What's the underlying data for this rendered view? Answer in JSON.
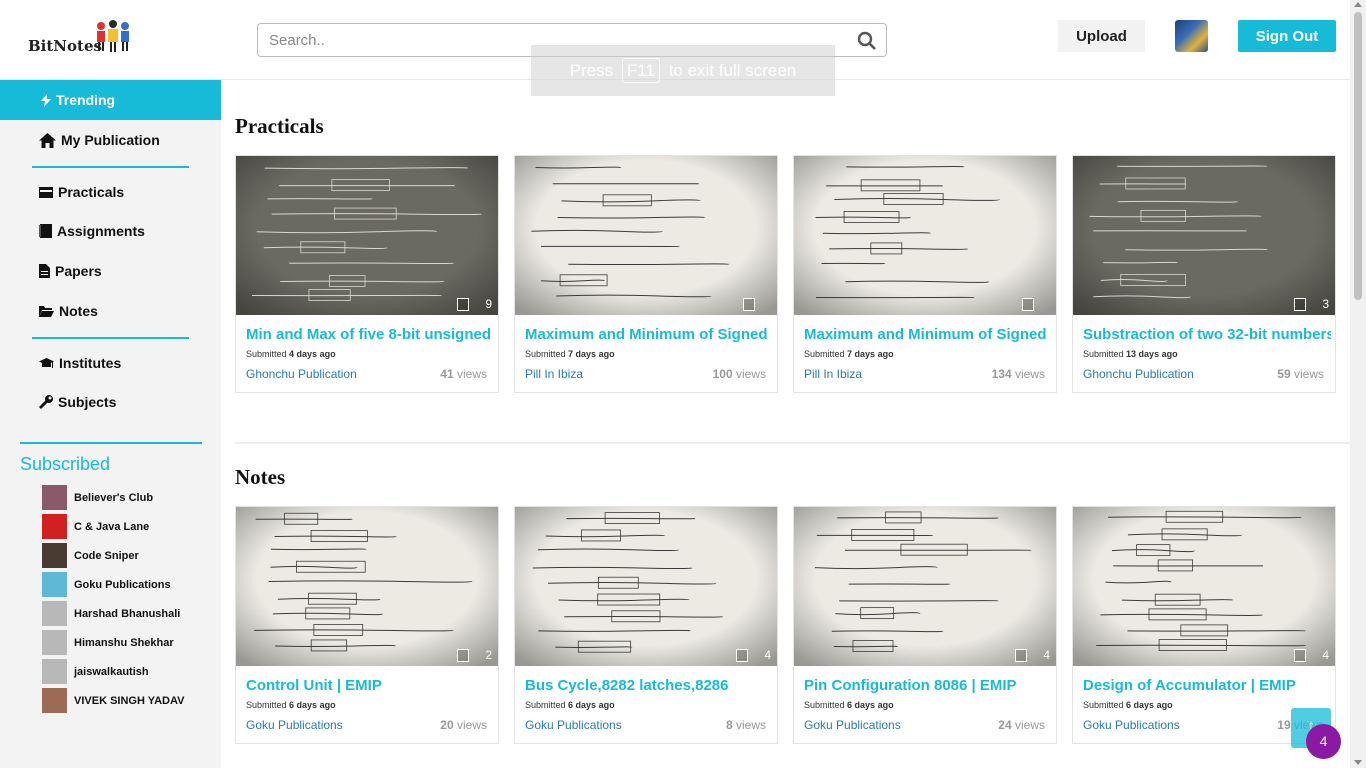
{
  "header": {
    "logo_text": "BitNotes",
    "search_placeholder": "Search..",
    "fullscreen_notice": {
      "before": "Press",
      "key": "F11",
      "after": "to exit full screen"
    },
    "upload_label": "Upload",
    "signout_label": "Sign Out"
  },
  "sidebar": {
    "trending": "Trending",
    "my_publication": "My Publication",
    "practicals": "Practicals",
    "assignments": "Assignments",
    "papers": "Papers",
    "notes": "Notes",
    "institutes": "Institutes",
    "subjects": "Subjects",
    "subscribed_title": "Subscribed",
    "subscribed": [
      {
        "name": "Believer's Club",
        "color": "#8a5a6b"
      },
      {
        "name": "C & Java Lane",
        "color": "#d21f1f"
      },
      {
        "name": "Code Sniper",
        "color": "#4a3b30"
      },
      {
        "name": "Goku Publications",
        "color": "#5fb8d6"
      },
      {
        "name": "Harshad Bhanushali",
        "color": "#b8b8b8"
      },
      {
        "name": "Himanshu Shekhar",
        "color": "#b8b8b8"
      },
      {
        "name": "jaiswalkautish",
        "color": "#b8b8b8"
      },
      {
        "name": "VIVEK SINGH YADAV",
        "color": "#9c6a55"
      }
    ]
  },
  "sections": {
    "practicals_title": "Practicals",
    "notes_title": "Notes"
  },
  "submitted_word": "Submitted",
  "views_word": "views",
  "practicals": [
    {
      "title": "Min and Max of five 8-bit unsigned",
      "age": "4 days ago",
      "publisher": "Ghonchu Publication",
      "views": "41",
      "pages": "9"
    },
    {
      "title": "Maximum and Minimum of Signed",
      "age": "7 days ago",
      "publisher": "Pill In Ibiza",
      "views": "100",
      "pages": ""
    },
    {
      "title": "Maximum and Minimum of Signed",
      "age": "7 days ago",
      "publisher": "Pill In Ibiza",
      "views": "134",
      "pages": ""
    },
    {
      "title": "Substraction of two 32-bit numbers",
      "age": "13 days ago",
      "publisher": "Ghonchu Publication",
      "views": "59",
      "pages": "3"
    }
  ],
  "notes": [
    {
      "title": "Control Unit | EMIP",
      "age": "6 days ago",
      "publisher": "Goku Publications",
      "views": "20",
      "pages": "2"
    },
    {
      "title": "Bus Cycle,8282 latches,8286",
      "age": "6 days ago",
      "publisher": "Goku Publications",
      "views": "8",
      "pages": "4"
    },
    {
      "title": "Pin Configuration 8086 | EMIP",
      "age": "6 days ago",
      "publisher": "Goku Publications",
      "views": "24",
      "pages": "4"
    },
    {
      "title": "Design of Accumulator | EMIP",
      "age": "6 days ago",
      "publisher": "Goku Publications",
      "views": "19",
      "pages": "4"
    }
  ],
  "to_top": "↑",
  "notification_count": "4",
  "accent_color": "#17bbd8"
}
